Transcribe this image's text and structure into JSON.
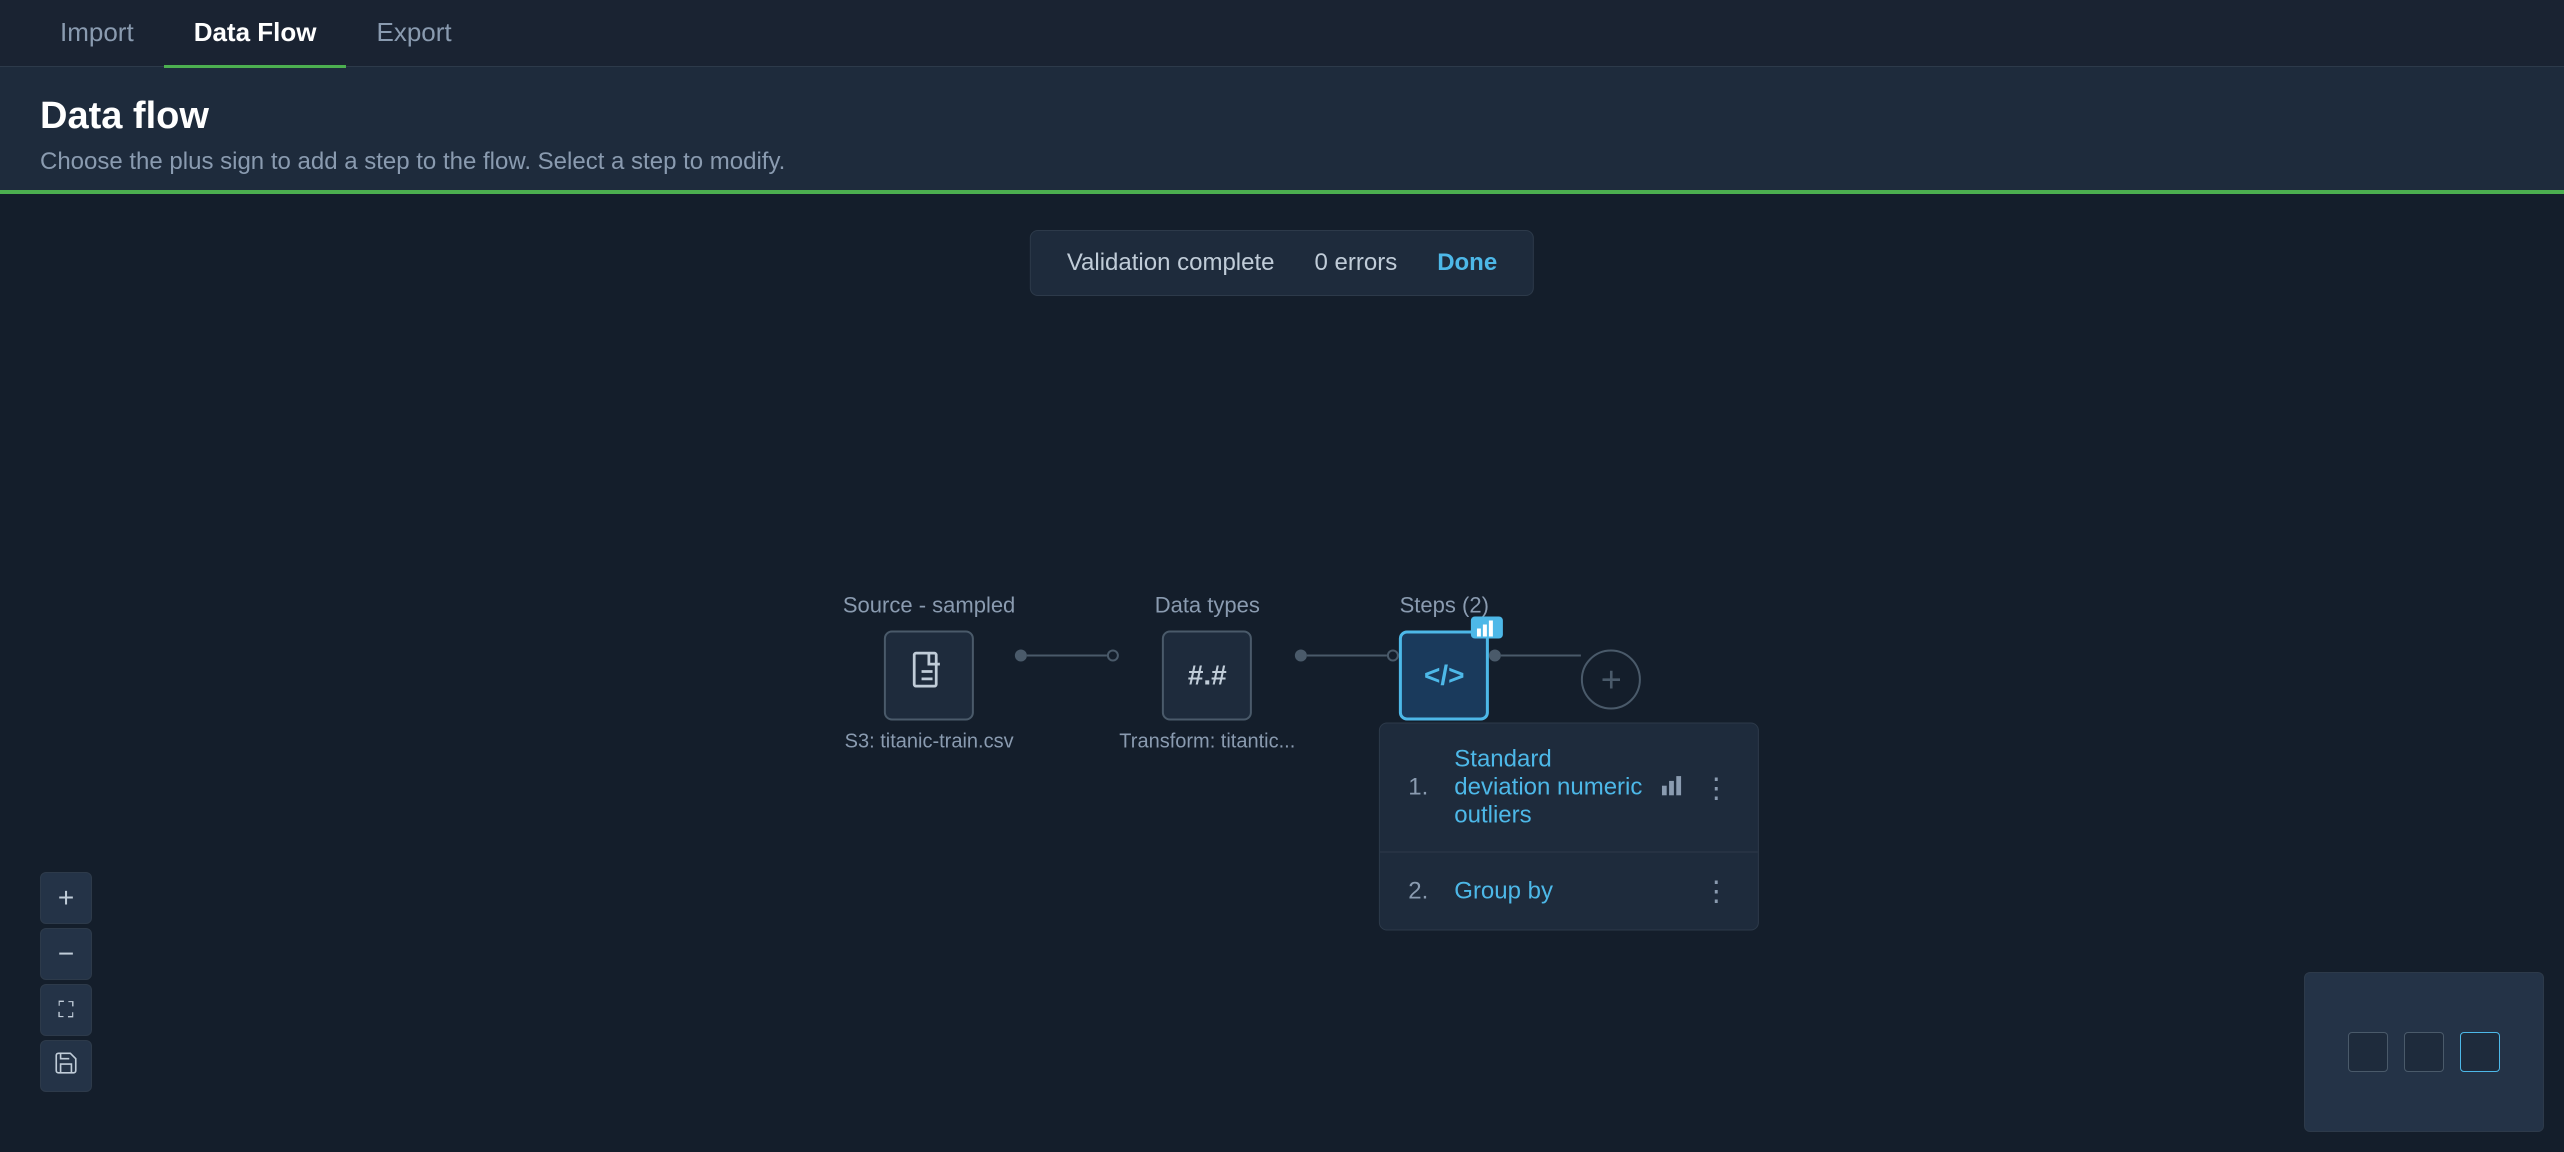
{
  "nav": {
    "tabs": [
      {
        "id": "import",
        "label": "Import",
        "active": false
      },
      {
        "id": "data-flow",
        "label": "Data Flow",
        "active": true
      },
      {
        "id": "export",
        "label": "Export",
        "active": false
      }
    ]
  },
  "header": {
    "title": "Data flow",
    "subtitle": "Choose the plus sign to add a step to the flow. Select a step to modify."
  },
  "validation": {
    "text": "Validation complete",
    "errors": "0 errors",
    "done_label": "Done"
  },
  "flow": {
    "nodes": [
      {
        "id": "source",
        "label": "Source - sampled",
        "sublabel": "S3: titanic-train.csv",
        "icon": "📄",
        "active": false
      },
      {
        "id": "datatypes",
        "label": "Data types",
        "sublabel": "Transform: titantic...",
        "icon": "#.#",
        "active": false
      },
      {
        "id": "steps",
        "label": "Steps (2)",
        "sublabel": "",
        "icon": "</>",
        "active": true,
        "badge": "▲"
      }
    ]
  },
  "steps_popup": {
    "items": [
      {
        "number": "1.",
        "name": "Standard deviation numeric outliers",
        "has_chart": true,
        "menu": "⋮"
      },
      {
        "number": "2.",
        "name": "Group by",
        "has_chart": false,
        "menu": "⋮"
      }
    ]
  },
  "zoom_controls": {
    "zoom_in": "+",
    "zoom_out": "−",
    "fit": "⛶",
    "save": "💾"
  }
}
